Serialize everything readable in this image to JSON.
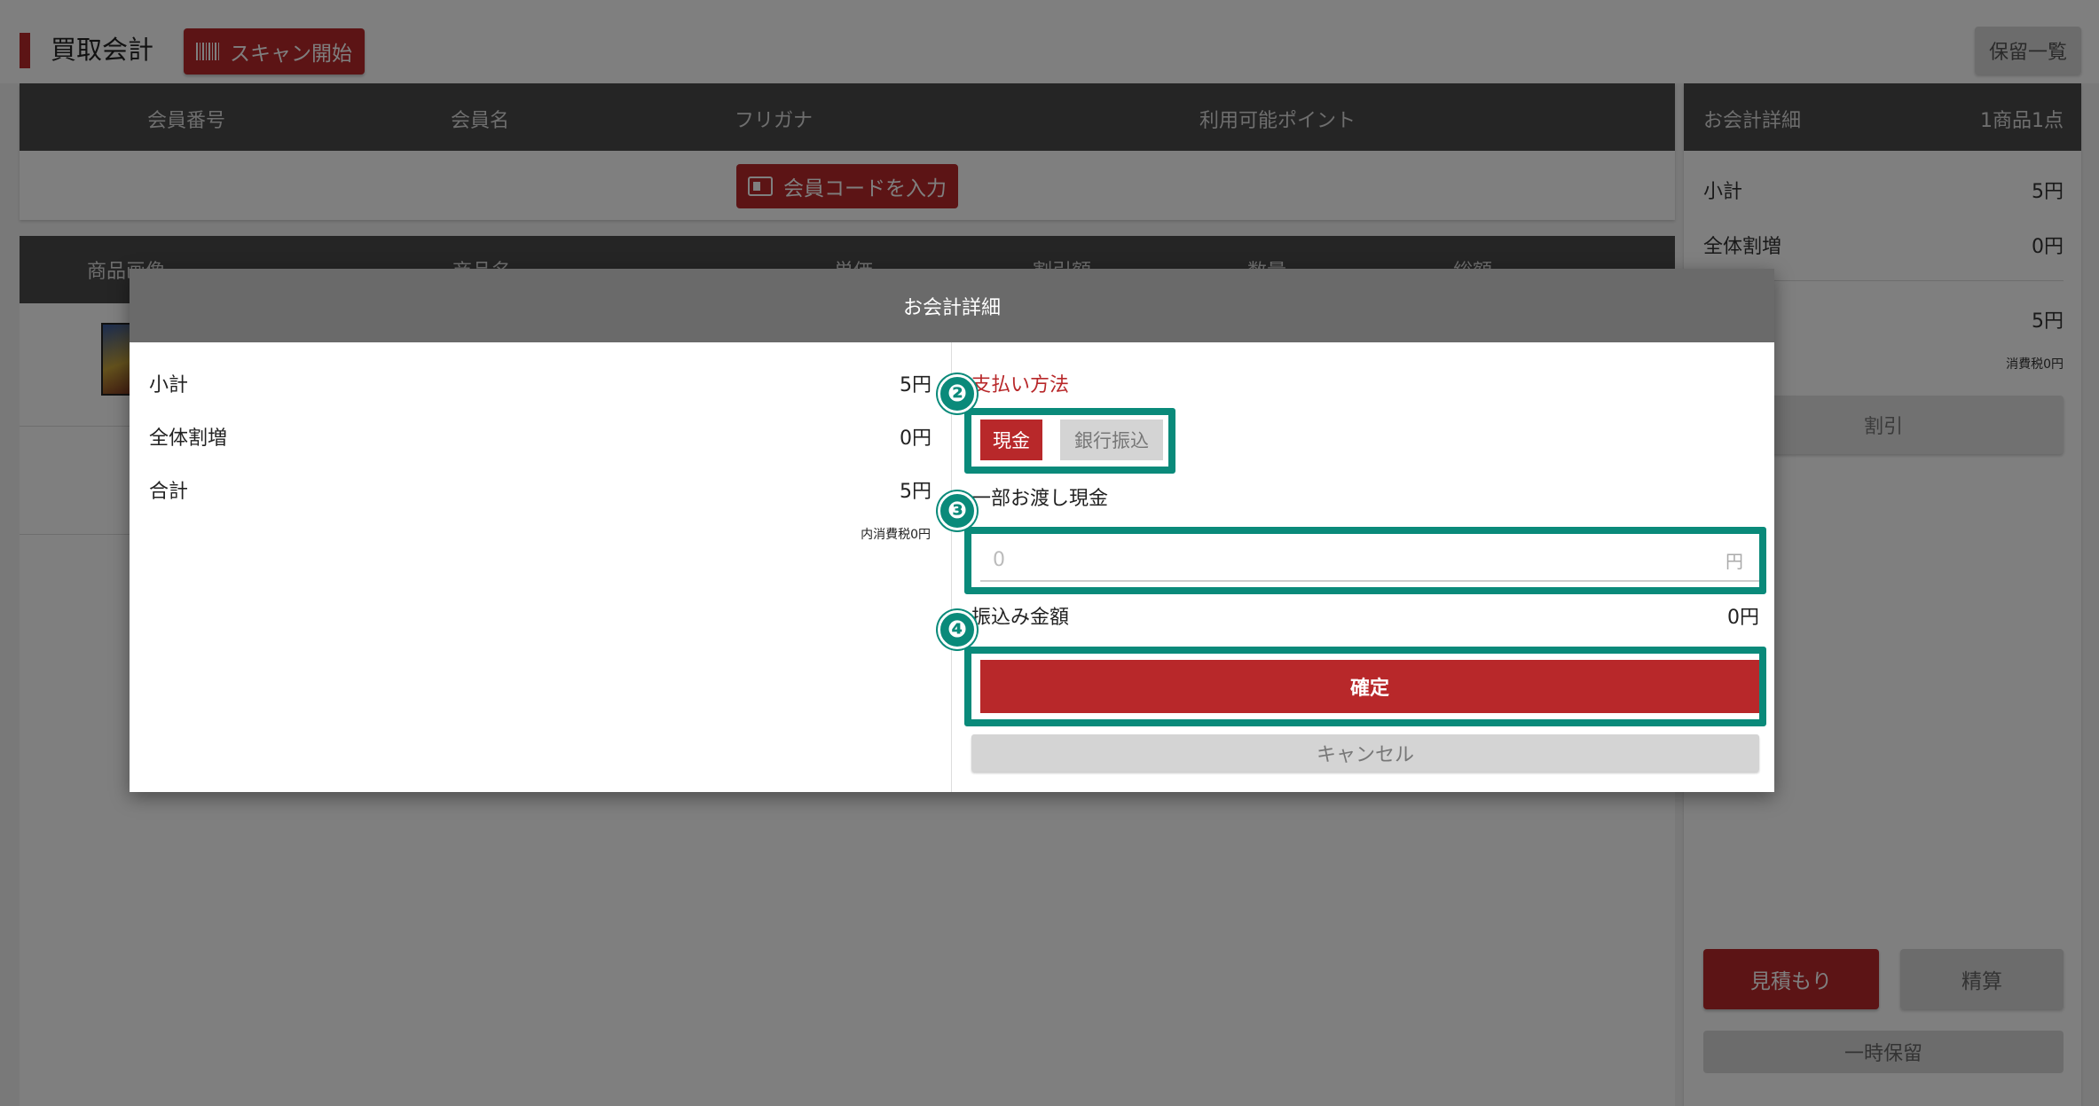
{
  "header": {
    "title": "買取会計",
    "scan_button": "スキャン開始",
    "hold_list_button": "保留一覧"
  },
  "member": {
    "columns": [
      "会員番号",
      "会員名",
      "フリガナ",
      "利用可能ポイント"
    ],
    "code_button": "会員コードを入力"
  },
  "products": {
    "columns": [
      "商品画像",
      "商品名",
      "単価",
      "割引額",
      "数量",
      "総額"
    ]
  },
  "summary": {
    "title": "お会計詳細",
    "count": "1商品1点",
    "subtotal_label": "小計",
    "subtotal_value": "5円",
    "overall_label": "全体割増",
    "overall_value": "0円",
    "total_value": "5円",
    "tax_note": "消費税0円",
    "discount_button": "割引",
    "quote_button": "見積もり",
    "settle_button": "精算",
    "temp_hold_button": "一時保留"
  },
  "modal": {
    "title": "お会計詳細",
    "subtotal_label": "小計",
    "subtotal_value": "5円",
    "overall_label": "全体割増",
    "overall_value": "0円",
    "total_label": "合計",
    "total_value": "5円",
    "tax_note": "内消費税0円",
    "payment_method_label": "支払い方法",
    "cash_option": "現金",
    "bank_option": "銀行振込",
    "partial_cash_label": "一部お渡し現金",
    "amount_placeholder": "0",
    "yen_suffix": "円",
    "transfer_label": "振込み金額",
    "transfer_value": "0円",
    "confirm_button": "確定",
    "cancel_button": "キャンセル"
  },
  "annotations": {
    "badge_2": "❷",
    "badge_3": "❸",
    "badge_4": "❹",
    "highlight_color": "#0a8a7a"
  },
  "colors": {
    "accent": "#b8282a",
    "header_dark": "#4a4a4a"
  }
}
